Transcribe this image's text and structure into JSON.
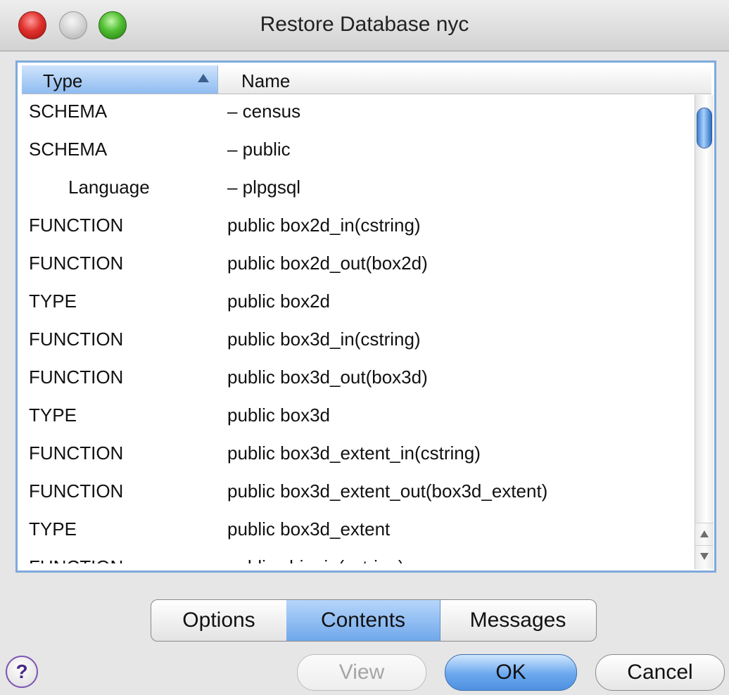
{
  "window": {
    "title": "Restore Database nyc"
  },
  "table": {
    "columns": {
      "type": "Type",
      "name": "Name"
    },
    "rows": [
      {
        "type": "SCHEMA",
        "name": "– census"
      },
      {
        "type": "SCHEMA",
        "name": "– public"
      },
      {
        "type": "Language",
        "name": "– plpgsql"
      },
      {
        "type": "FUNCTION",
        "name": "public box2d_in(cstring)"
      },
      {
        "type": "FUNCTION",
        "name": "public box2d_out(box2d)"
      },
      {
        "type": "TYPE",
        "name": "public box2d"
      },
      {
        "type": "FUNCTION",
        "name": "public box3d_in(cstring)"
      },
      {
        "type": "FUNCTION",
        "name": "public box3d_out(box3d)"
      },
      {
        "type": "TYPE",
        "name": "public box3d"
      },
      {
        "type": "FUNCTION",
        "name": "public box3d_extent_in(cstring)"
      },
      {
        "type": "FUNCTION",
        "name": "public box3d_extent_out(box3d_extent)"
      },
      {
        "type": "TYPE",
        "name": "public box3d_extent"
      },
      {
        "type": "FUNCTION",
        "name": "public chip_in(cstring)"
      }
    ]
  },
  "tabs": {
    "options": "Options",
    "contents": "Contents",
    "messages": "Messages",
    "selected": "Contents"
  },
  "buttons": {
    "help": "?",
    "view": "View",
    "ok": "OK",
    "cancel": "Cancel"
  },
  "colors": {
    "accent": "#6fa7ea",
    "close": "#e0312c",
    "maximize": "#4fbd31"
  }
}
